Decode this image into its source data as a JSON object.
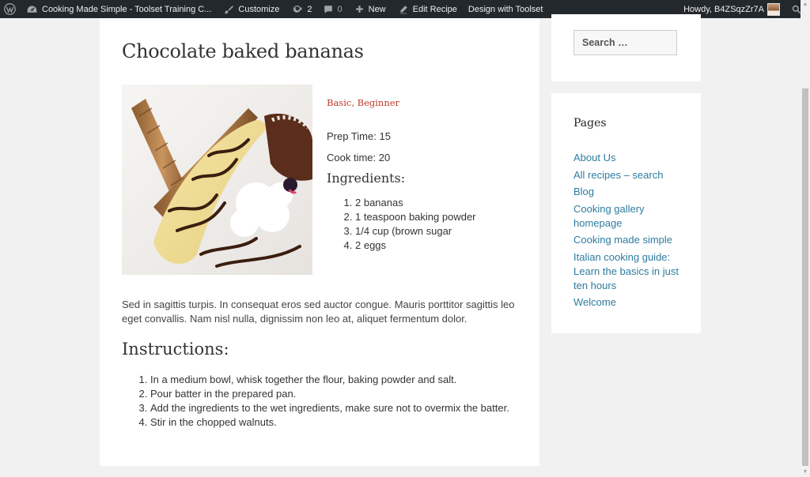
{
  "adminbar": {
    "site_name": "Cooking Made Simple - Toolset Training C...",
    "customize": "Customize",
    "updates_count": "2",
    "comments_count": "0",
    "new_label": "New",
    "edit_label": "Edit Recipe",
    "design_label": "Design with Toolset",
    "howdy": "Howdy, B4ZSqzZr7A"
  },
  "post": {
    "title": "Chocolate baked bananas",
    "categories": "Basic, Beginner",
    "prep_time": "Prep Time: 15",
    "cook_time": "Cook time: 20",
    "ingredients_title": "Ingredients:",
    "ingredients": [
      "2 bananas",
      "1 teaspoon baking powder",
      "1/4 cup (brown sugar",
      "2 eggs"
    ],
    "description": "Sed in sagittis turpis. In consequat eros sed auctor congue. Mauris porttitor sagittis leo eget convallis. Nam nisl nulla, dignissim non leo at, aliquet fermentum dolor.",
    "instructions_title": "Instructions:",
    "instructions": [
      "In a medium bowl, whisk together the flour, baking powder and salt.",
      "Pour batter in the prepared pan.",
      "Add the ingredients to the wet ingredients, make sure not to overmix the batter.",
      "Stir in the chopped walnuts."
    ]
  },
  "sidebar": {
    "search_placeholder": "Search …",
    "pages_title": "Pages",
    "pages": [
      "About Us",
      "All recipes – search",
      "Blog",
      "Cooking gallery homepage",
      "Cooking made simple",
      "Italian cooking guide: Learn the basics in just ten hours",
      "Welcome"
    ]
  },
  "colors": {
    "adminbar_bg": "#23282d",
    "link": "#2e7ca0",
    "category": "#c0392b"
  }
}
